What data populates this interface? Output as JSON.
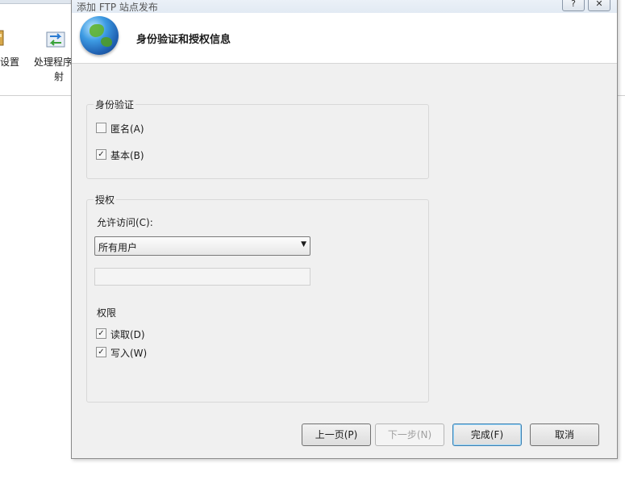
{
  "background_window": {
    "tools": [
      {
        "label": "设置",
        "icon": "settings-icon"
      },
      {
        "label_line1": "处理程序",
        "label_line2": "射",
        "icon": "handler-mappings-icon"
      }
    ]
  },
  "dialog": {
    "title": "添加 FTP 站点发布",
    "help_glyph": "?",
    "close_glyph": "✕",
    "header_title": "身份验证和授权信息",
    "header_icon": "globe-icon",
    "authentication": {
      "legend": "身份验证",
      "anonymous": {
        "label": "匿名(A)",
        "checked": false
      },
      "basic": {
        "label": "基本(B)",
        "checked": true
      }
    },
    "authorization": {
      "legend": "授权",
      "allow_access_label": "允许访问(C):",
      "allow_access_value": "所有用户",
      "permissions_label": "权限",
      "read": {
        "label": "读取(D)",
        "checked": true
      },
      "write": {
        "label": "写入(W)",
        "checked": true
      }
    },
    "buttons": {
      "previous": "上一页(P)",
      "next": "下一步(N)",
      "finish": "完成(F)",
      "cancel": "取消"
    }
  },
  "colors": {
    "dialog_bg": "#f0f0f0",
    "header_bg": "#ffffff",
    "default_button_border": "#3c7fb1"
  }
}
